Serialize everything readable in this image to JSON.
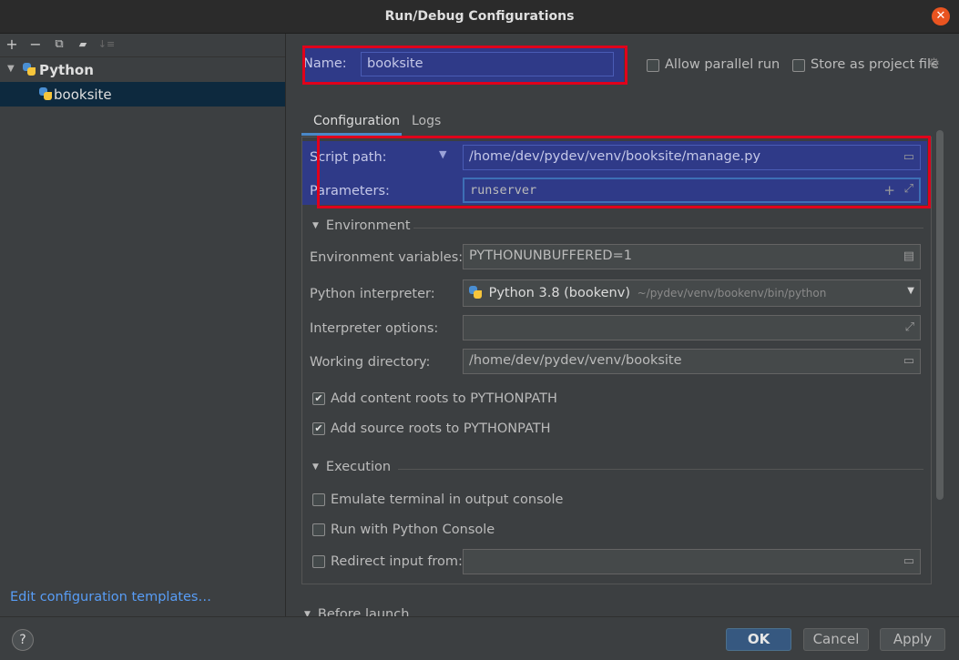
{
  "window": {
    "title": "Run/Debug Configurations"
  },
  "toolbar": {
    "add": "+",
    "remove": "−",
    "copy": "⧉",
    "folder": "▰",
    "sort": "↓≡"
  },
  "tree": {
    "group": "Python",
    "items": [
      {
        "label": "booksite"
      }
    ]
  },
  "left_footer": {
    "edit_templates": "Edit configuration templates…"
  },
  "header": {
    "name_label": "Name:",
    "name_value": "booksite",
    "allow_parallel": "Allow parallel run",
    "store_project": "Store as project file"
  },
  "tabs": [
    {
      "label": "Configuration"
    },
    {
      "label": "Logs"
    }
  ],
  "config": {
    "script_path_label": "Script path:",
    "script_path_value": "/home/dev/pydev/venv/booksite/manage.py",
    "parameters_label": "Parameters:",
    "parameters_value": "runserver",
    "environment_section": "Environment",
    "env_vars_label": "Environment variables:",
    "env_vars_value": "PYTHONUNBUFFERED=1",
    "interpreter_label": "Python interpreter:",
    "interpreter_name": "Python 3.8 (bookenv)",
    "interpreter_path": "~/pydev/venv/bookenv/bin/python",
    "interp_options_label": "Interpreter options:",
    "interp_options_value": "",
    "workdir_label": "Working directory:",
    "workdir_value": "/home/dev/pydev/venv/booksite",
    "add_content_roots": "Add content roots to PYTHONPATH",
    "add_source_roots": "Add source roots to PYTHONPATH",
    "execution_section": "Execution",
    "emulate_terminal": "Emulate terminal in output console",
    "run_python_console": "Run with Python Console",
    "redirect_input": "Redirect input from:",
    "redirect_value": "",
    "before_launch": "Before launch"
  },
  "buttons": {
    "help": "?",
    "ok": "OK",
    "cancel": "Cancel",
    "apply": "Apply"
  },
  "colors": {
    "accent": "#365880",
    "highlight": "#2f3a88",
    "annotation": "#e0001b",
    "link": "#589df6"
  }
}
